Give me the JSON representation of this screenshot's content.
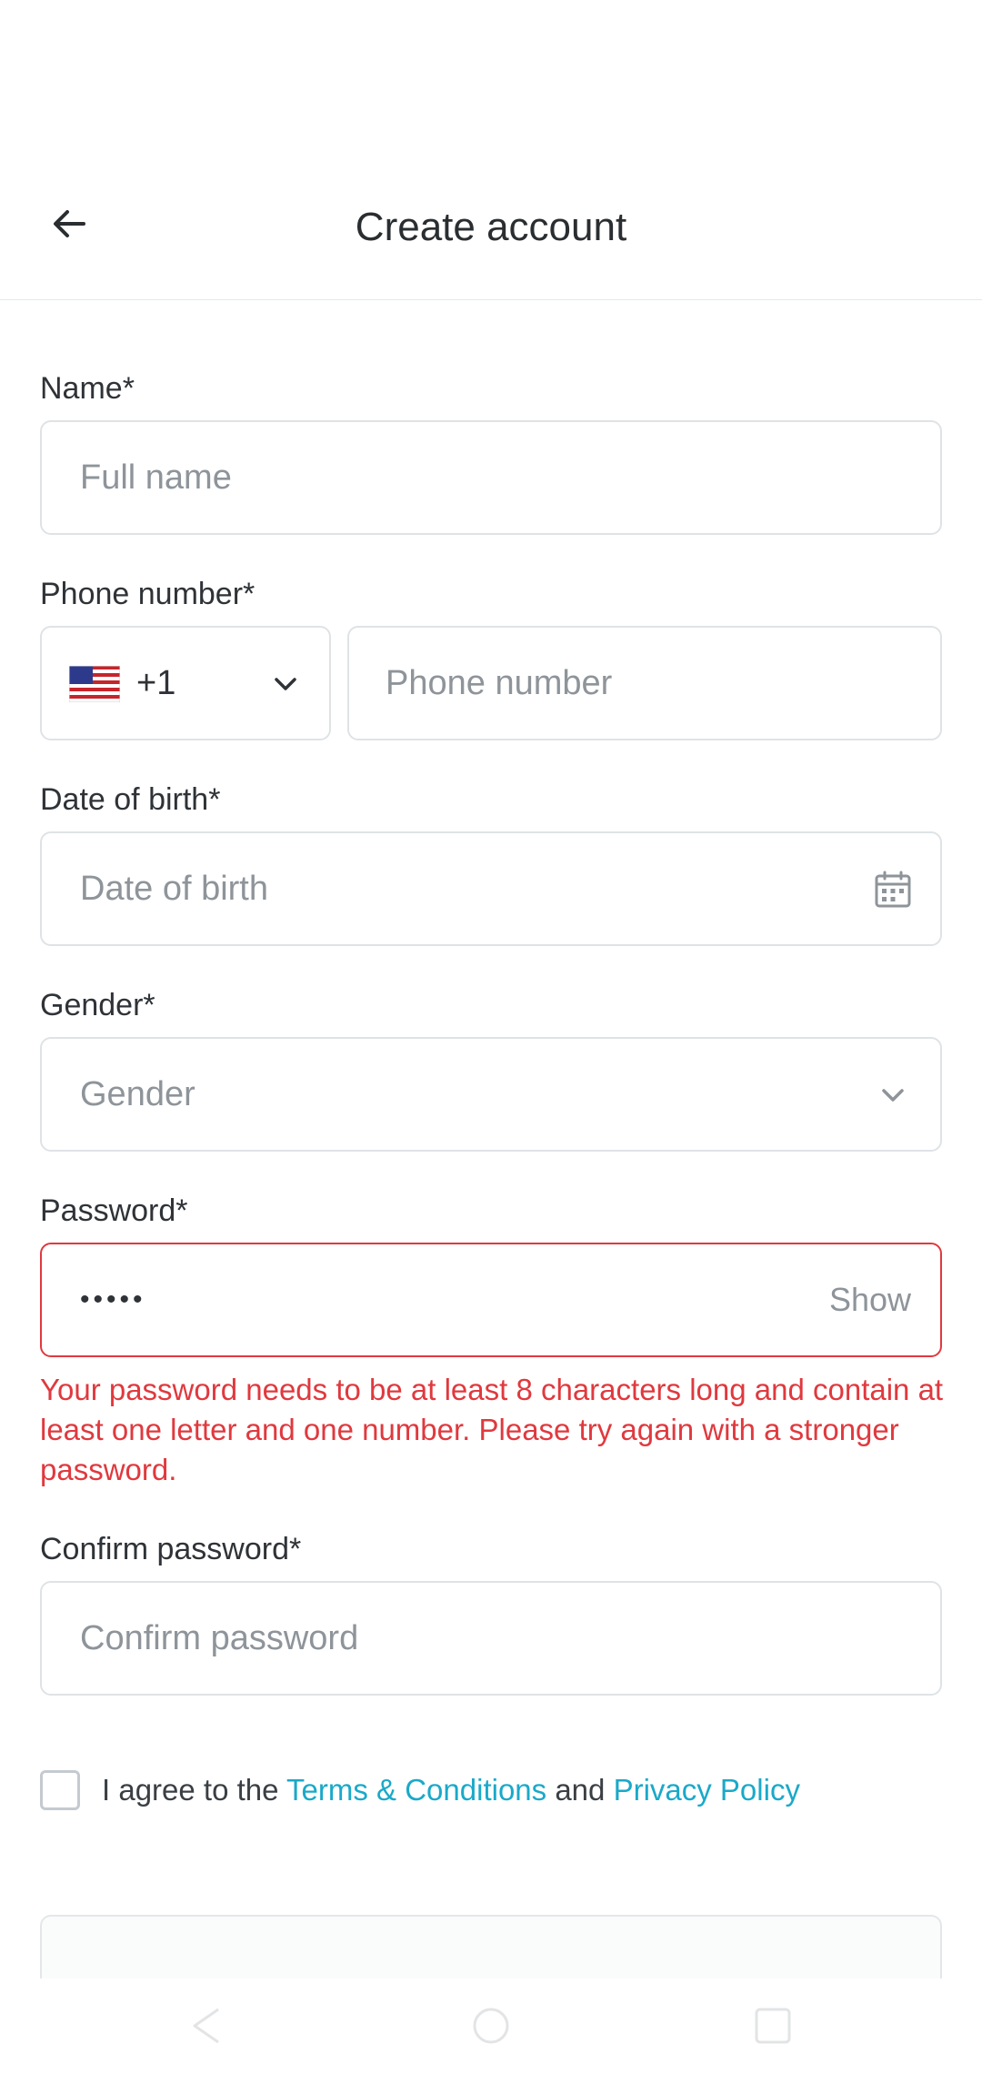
{
  "header": {
    "title": "Create account",
    "back_icon": "arrow-left-icon"
  },
  "form": {
    "name": {
      "label": "Name*",
      "placeholder": "Full name"
    },
    "phone": {
      "label": "Phone number*",
      "country_flag": "us-flag-icon",
      "dial_code": "+1",
      "placeholder": "Phone number"
    },
    "dob": {
      "label": "Date of birth*",
      "placeholder": "Date of birth",
      "icon": "calendar-icon"
    },
    "gender": {
      "label": "Gender*",
      "placeholder": "Gender"
    },
    "password": {
      "label": "Password*",
      "masked_value": "•••••",
      "toggle_label": "Show",
      "error": "Your password needs to be at least 8 characters long and contain at least one letter and one number. Please try again with a stronger password."
    },
    "confirm_password": {
      "label": "Confirm password*",
      "placeholder": "Confirm password"
    },
    "terms": {
      "prefix": "I agree to the ",
      "terms_link": "Terms & Conditions",
      "conjunction": " and ",
      "privacy_link": "Privacy Policy",
      "checked": false
    }
  },
  "colors": {
    "error": "#e0393e",
    "link": "#1aa9c9",
    "border": "#dfe3e6"
  }
}
